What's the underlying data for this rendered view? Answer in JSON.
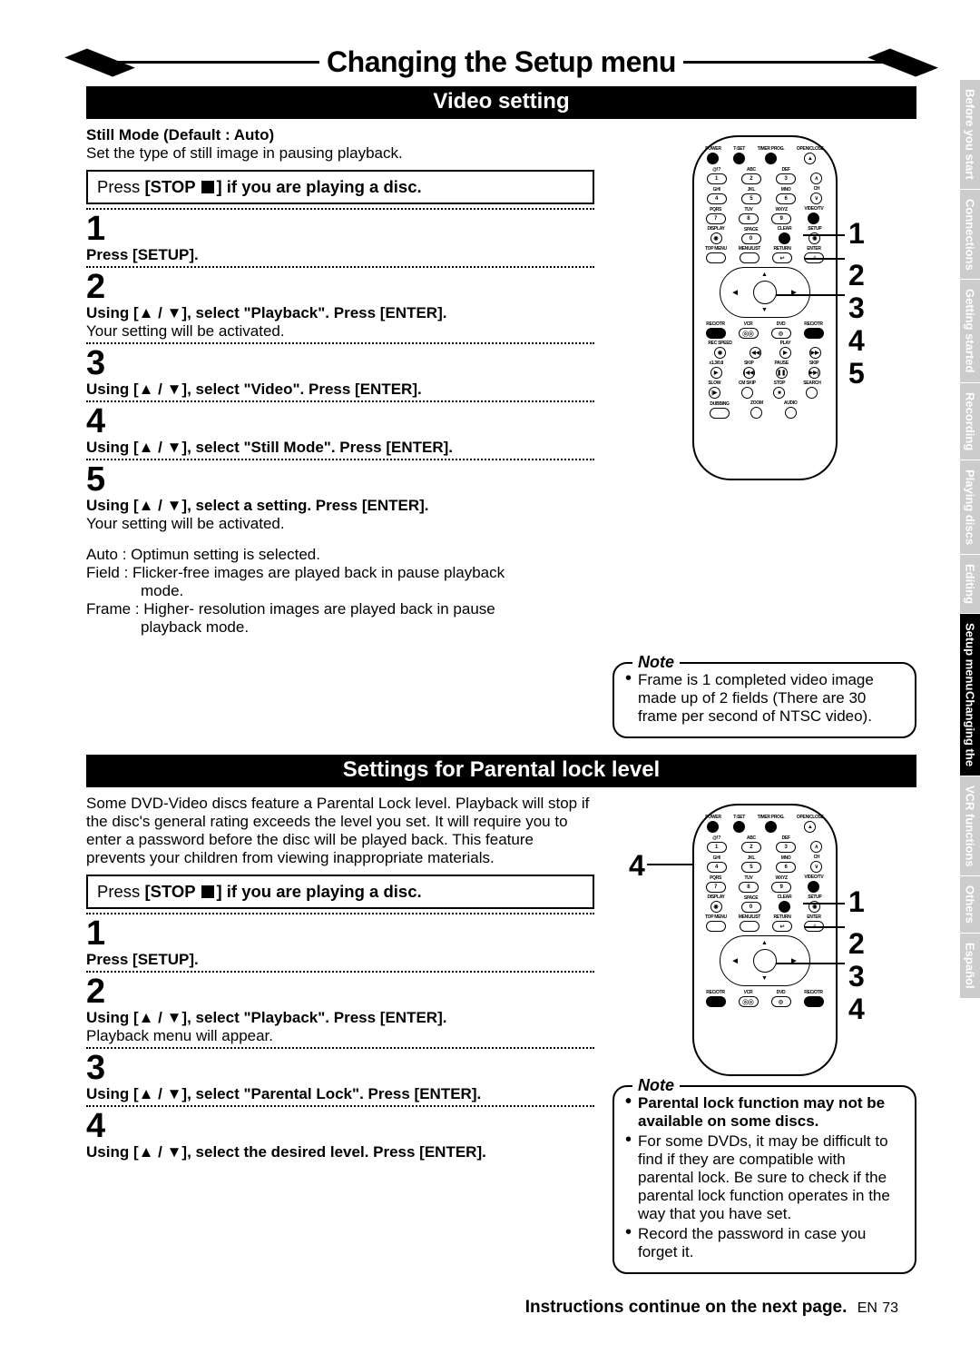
{
  "title": "Changing the Setup menu",
  "video": {
    "header": "Video setting",
    "intro_bold": "Still Mode (Default : Auto)",
    "intro_text": "Set the type of still image in pausing playback.",
    "press_stop_pre": "Press ",
    "press_stop_bold": "[STOP ",
    "press_stop_post": "] if you are playing a disc.",
    "steps": {
      "n1": "1",
      "s1": "Press [SETUP].",
      "n2": "2",
      "s2": "Using [▲ / ▼], select \"Playback\". Press [ENTER].",
      "s2b": "Your setting will be activated.",
      "n3": "3",
      "s3": "Using [▲ / ▼], select \"Video\". Press [ENTER].",
      "n4": "4",
      "s4": "Using [▲ / ▼], select \"Still Mode\". Press [ENTER].",
      "n5": "5",
      "s5": "Using [▲ / ▼], select a setting. Press [ENTER].",
      "s5b": "Your setting will be activated."
    },
    "opts": {
      "auto": "Auto : Optimun setting is selected.",
      "field": "Field : Flicker-free images are played back in pause playback",
      "field2": "mode.",
      "frame": "Frame : Higher- resolution images are played back in pause",
      "frame2": "playback mode."
    },
    "note_label": "Note",
    "note1": "Frame is 1 completed video image made up of 2 fields (There are 30 frame per second of NTSC video).",
    "callouts": {
      "c1": "1",
      "c2": "2",
      "c3": "3",
      "c4": "4",
      "c5": "5"
    }
  },
  "parental": {
    "header": "Settings for Parental lock level",
    "intro": "Some DVD-Video discs feature a Parental Lock level. Playback will stop if the disc's general rating exceeds the level you set. It will require you to enter a password before the disc will be played back. This feature prevents your children from viewing inappropriate materials.",
    "press_stop_pre": "Press ",
    "press_stop_bold": "[STOP ",
    "press_stop_post": "] if you are playing a disc.",
    "steps": {
      "n1": "1",
      "s1": "Press [SETUP].",
      "n2": "2",
      "s2": "Using [▲ / ▼], select \"Playback\". Press [ENTER].",
      "s2b": "Playback menu will appear.",
      "n3": "3",
      "s3": "Using [▲ / ▼], select \"Parental Lock\". Press [ENTER].",
      "n4": "4",
      "s4": "Using [▲ / ▼], select the desired level. Press [ENTER]."
    },
    "note_label": "Note",
    "note1_bold": "Parental lock function may not be available on some discs.",
    "note2": "For some DVDs, it may be difficult to find if they are compatible with parental lock. Be sure to check if the parental lock function operates in the way that you have set.",
    "note3": "Record the password in case you forget it.",
    "callout_left": "4",
    "callouts": {
      "c1": "1",
      "c2": "2",
      "c3": "3",
      "c4": "4"
    }
  },
  "remote_labels": {
    "power": "POWER",
    "tset": "T-SET",
    "timer": "TIMER PROG.",
    "open": "OPEN/CLOSE",
    "abc": "ABC",
    "def": "DEF",
    "ghi": "GHI",
    "jkl": "JKL",
    "mno": "MNO",
    "ch": "CH",
    "pqrs": "PQRS",
    "tuv": "TUV",
    "wxyz": "WXYZ",
    "vidtv": "VIDEO/TV",
    "display": "DISPLAY",
    "space": "SPACE",
    "clear": "CLEAR",
    "setup": "SETUP",
    "topmenu": "TOP MENU",
    "menulist": "MENU/LIST",
    "return": "RETURN",
    "enter": "ENTER",
    "recotr": "REC/OTR",
    "vcr": "VCR",
    "dvd": "DVD",
    "recspeed": "REC SPEED",
    "play": "PLAY",
    "x13x1": "x1.3/0.8",
    "skip": "SKIP",
    "pause": "PAUSE",
    "slow": "SLOW",
    "cmskip": "CM SKIP",
    "stop": "STOP",
    "search": "SEARCH",
    "dubbing": "DUBBING",
    "zoom": "ZOOM",
    "audio": "AUDIO",
    "d1": "1",
    "d2": "2",
    "d3": "3",
    "d4": "4",
    "d5": "5",
    "d6": "6",
    "d7": "7",
    "d8": "8",
    "d9": "9",
    "d0": "0",
    "at": "@!?"
  },
  "tabs": {
    "t1": "Before you start",
    "t2": "Connections",
    "t3": "Getting started",
    "t4": "Recording",
    "t5": "Playing discs",
    "t6": "Editing",
    "t7a": "Changing the",
    "t7b": "Setup menu",
    "t8": "VCR functions",
    "t9": "Others",
    "t10": "Español"
  },
  "footer": {
    "text": "Instructions continue on the next page.",
    "en": "EN",
    "page": "73"
  }
}
